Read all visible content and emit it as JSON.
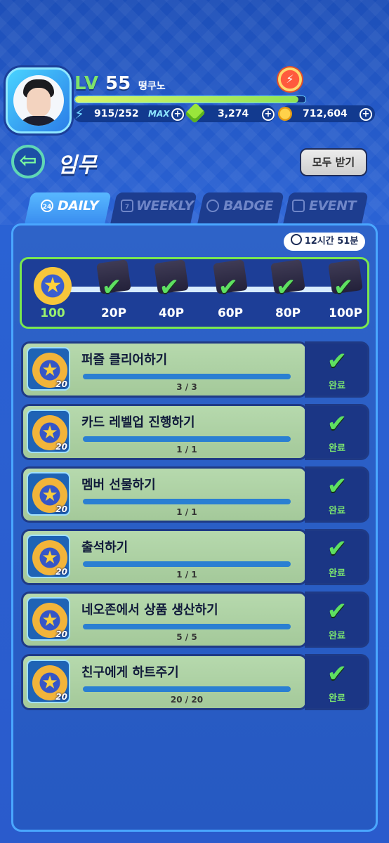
{
  "player": {
    "lv_label": "LV",
    "level": "55",
    "name": "떵쿠노",
    "energy": "915/252",
    "energy_max_label": "MAX",
    "gems": "3,274",
    "coins": "712,604"
  },
  "header": {
    "title": "임무",
    "claim_all": "모두 받기"
  },
  "tabs": [
    {
      "label": "DAILY",
      "icon": "24",
      "active": true
    },
    {
      "label": "WEEKLY",
      "icon": "7",
      "active": false
    },
    {
      "label": "BADGE",
      "icon": "",
      "active": false
    },
    {
      "label": "EVENT",
      "icon": "",
      "active": false
    }
  ],
  "timer": "12시간 51분",
  "milestones": {
    "current_points": "100",
    "steps": [
      "20P",
      "40P",
      "60P",
      "80P",
      "100P"
    ]
  },
  "missions": [
    {
      "title": "퍼즐 클리어하기",
      "progress": "3 / 3",
      "reward": "20",
      "status": "완료"
    },
    {
      "title": "카드 레벨업 진행하기",
      "progress": "1 / 1",
      "reward": "20",
      "status": "완료"
    },
    {
      "title": "멤버 선물하기",
      "progress": "1 / 1",
      "reward": "20",
      "status": "완료"
    },
    {
      "title": "출석하기",
      "progress": "1 / 1",
      "reward": "20",
      "status": "완료"
    },
    {
      "title": "네오존에서 상품 생산하기",
      "progress": "5 / 5",
      "reward": "20",
      "status": "완료"
    },
    {
      "title": "친구에게 하트주기",
      "progress": "20 / 20",
      "reward": "20",
      "status": "완료"
    }
  ],
  "colors": {
    "accent_green": "#5ee061",
    "panel_blue": "#2659c2",
    "tab_active": "#3a8ef0"
  }
}
